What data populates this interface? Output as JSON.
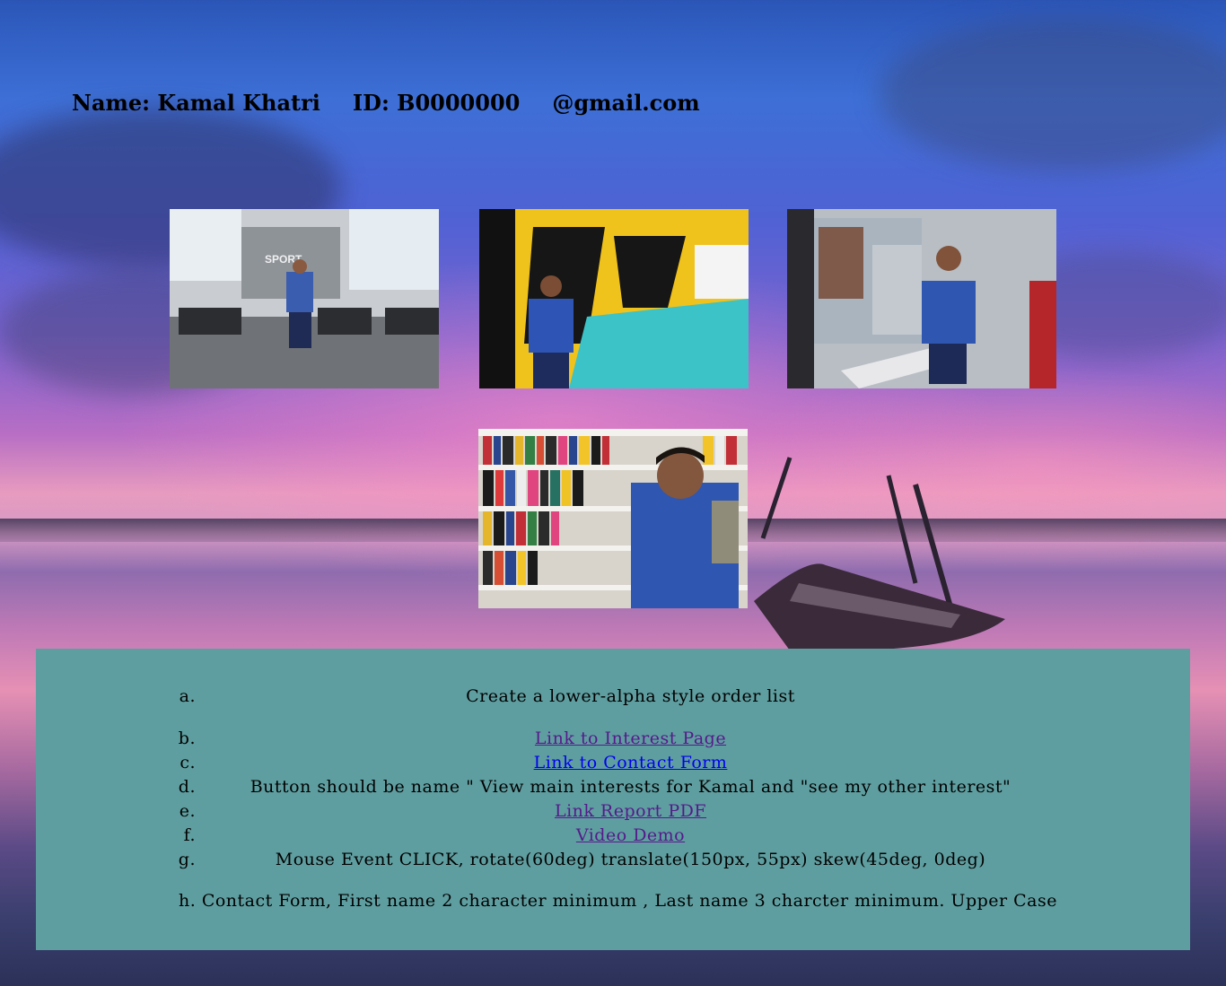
{
  "header": {
    "name": "Name: Kamal Khatri",
    "id": "ID: B0000000",
    "email": "@gmail.com"
  },
  "photos": [
    {
      "subject": "gym-photo"
    },
    {
      "subject": "mural-photo"
    },
    {
      "subject": "window-photo"
    },
    {
      "subject": "library-photo"
    }
  ],
  "list": {
    "items": [
      {
        "marker": "a.",
        "text": "Create a lower-alpha style order list"
      },
      {
        "marker": "b.",
        "text": "Link to Interest Page",
        "link_state": "visited"
      },
      {
        "marker": "c.",
        "text": "Link to Contact Form",
        "link_state": "unvisited"
      },
      {
        "marker": "d.",
        "text": "Button should be name \" View main interests for Kamal and \"see my other interest\""
      },
      {
        "marker": "e.",
        "text": "Link Report PDF",
        "link_state": "visited"
      },
      {
        "marker": "f.",
        "text": "Video Demo",
        "link_state": "visited"
      },
      {
        "marker": "g.",
        "text": "Mouse Event CLICK, rotate(60deg) translate(150px, 55px) skew(45deg, 0deg)"
      }
    ],
    "last": "h. Contact Form, First name 2 character minimum , Last name 3 charcter minimum. Upper Case"
  },
  "colors": {
    "panel": "#5f9ea0",
    "link_visited": "#551a8b",
    "link_unvisited": "#0000ee"
  }
}
